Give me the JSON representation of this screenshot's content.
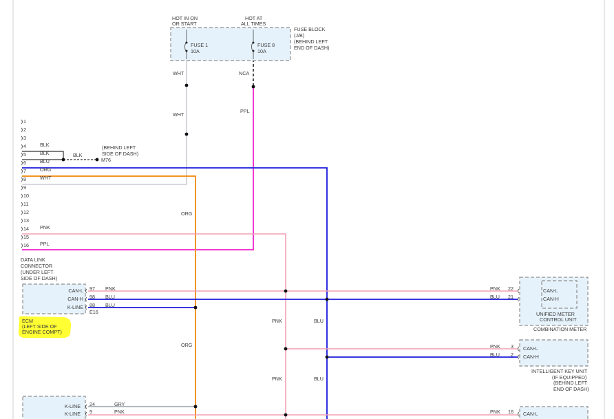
{
  "colors": {
    "WHT": "#c8ccd6",
    "PPL": "#ee22cc",
    "BLU": "#1a1adc",
    "ORG": "#f09426",
    "PNK": "#f4a0b4",
    "BLK": "#333333",
    "GRY": "#9aa0a6",
    "box_fill": "#e6f2fb",
    "highlight": "#ffff33"
  },
  "power": {
    "hot_run": [
      "HOT IN ON",
      "OR START"
    ],
    "hot_all": [
      "HOT AT",
      "ALL TIMES"
    ],
    "fuse1": [
      "FUSE 1",
      "10A"
    ],
    "fuse8": [
      "FUSE 8",
      "10A"
    ],
    "fuse_block": [
      "FUSE BLOCK",
      "(J/B)",
      "(BEHIND LEFT",
      "END OF DASH)"
    ]
  },
  "wire_labels": {
    "wht_a": "WHT",
    "wht_b": "WHT",
    "nca": "NCA",
    "ppl": "PPL",
    "org_a": "ORG",
    "org_b": "ORG",
    "pnk_a": "PNK",
    "pnk_b": "PNK",
    "blu_a": "BLU",
    "blu_b": "BLU"
  },
  "dlc": {
    "pins": [
      "1",
      "2",
      "3",
      "4",
      "5",
      "6",
      "7",
      "8",
      "9",
      "10",
      "11",
      "12",
      "13",
      "14",
      "15",
      "16"
    ],
    "wire_labels": {
      "4": "BLK",
      "5": "BLK",
      "6": "BLU",
      "7": "ORG",
      "8": "WHT",
      "14": "PNK",
      "16": "PPL"
    },
    "ground_wire": "BLK",
    "ground_note": [
      "(BEHIND LEFT",
      "SIDE OF DASH)"
    ],
    "ground_id": "M76",
    "name": [
      "DATA LINK",
      "CONNECTOR",
      "(UNDER LEFT",
      "SIDE OF DASH)"
    ]
  },
  "ecm": {
    "pins": [
      {
        "label": "CAN-L",
        "num": "97",
        "wire": "PNK"
      },
      {
        "label": "CAN-H",
        "num": "98",
        "wire": "BLU"
      },
      {
        "label": "K-LINE",
        "num": "88",
        "wire": "BLU"
      }
    ],
    "connector": "E16",
    "name": [
      "ECM",
      "(LEFT SIDE OF",
      "ENGINE COMPT)"
    ]
  },
  "meter": {
    "pins": [
      {
        "label": "CAN-L",
        "num": "22",
        "wire": "PNK"
      },
      {
        "label": "CAN-H",
        "num": "21",
        "wire": "BLU"
      }
    ],
    "inner": [
      "UNIFIED METER",
      "CONTROL UNIT"
    ],
    "name": "COMBINATION METER"
  },
  "iku": {
    "pins": [
      {
        "label": "CAN-L",
        "num": "3",
        "wire": "PNK"
      },
      {
        "label": "CAN-H",
        "num": "2",
        "wire": "BLU"
      }
    ],
    "name": [
      "INTELLIGENT KEY UNIT",
      "(IF EQUIPPED)",
      "(BEHIND LEFT",
      "END OF DASH)"
    ]
  },
  "bottom_left": {
    "pins": [
      {
        "label": "K-LINE",
        "num": "24",
        "wire": "GRY"
      },
      {
        "label": "K-LINE",
        "num": "9",
        "wire": "PNK"
      }
    ]
  },
  "bottom_right": {
    "pins": [
      {
        "label": "CAN-L",
        "num": "16",
        "wire": "PNK"
      }
    ]
  }
}
